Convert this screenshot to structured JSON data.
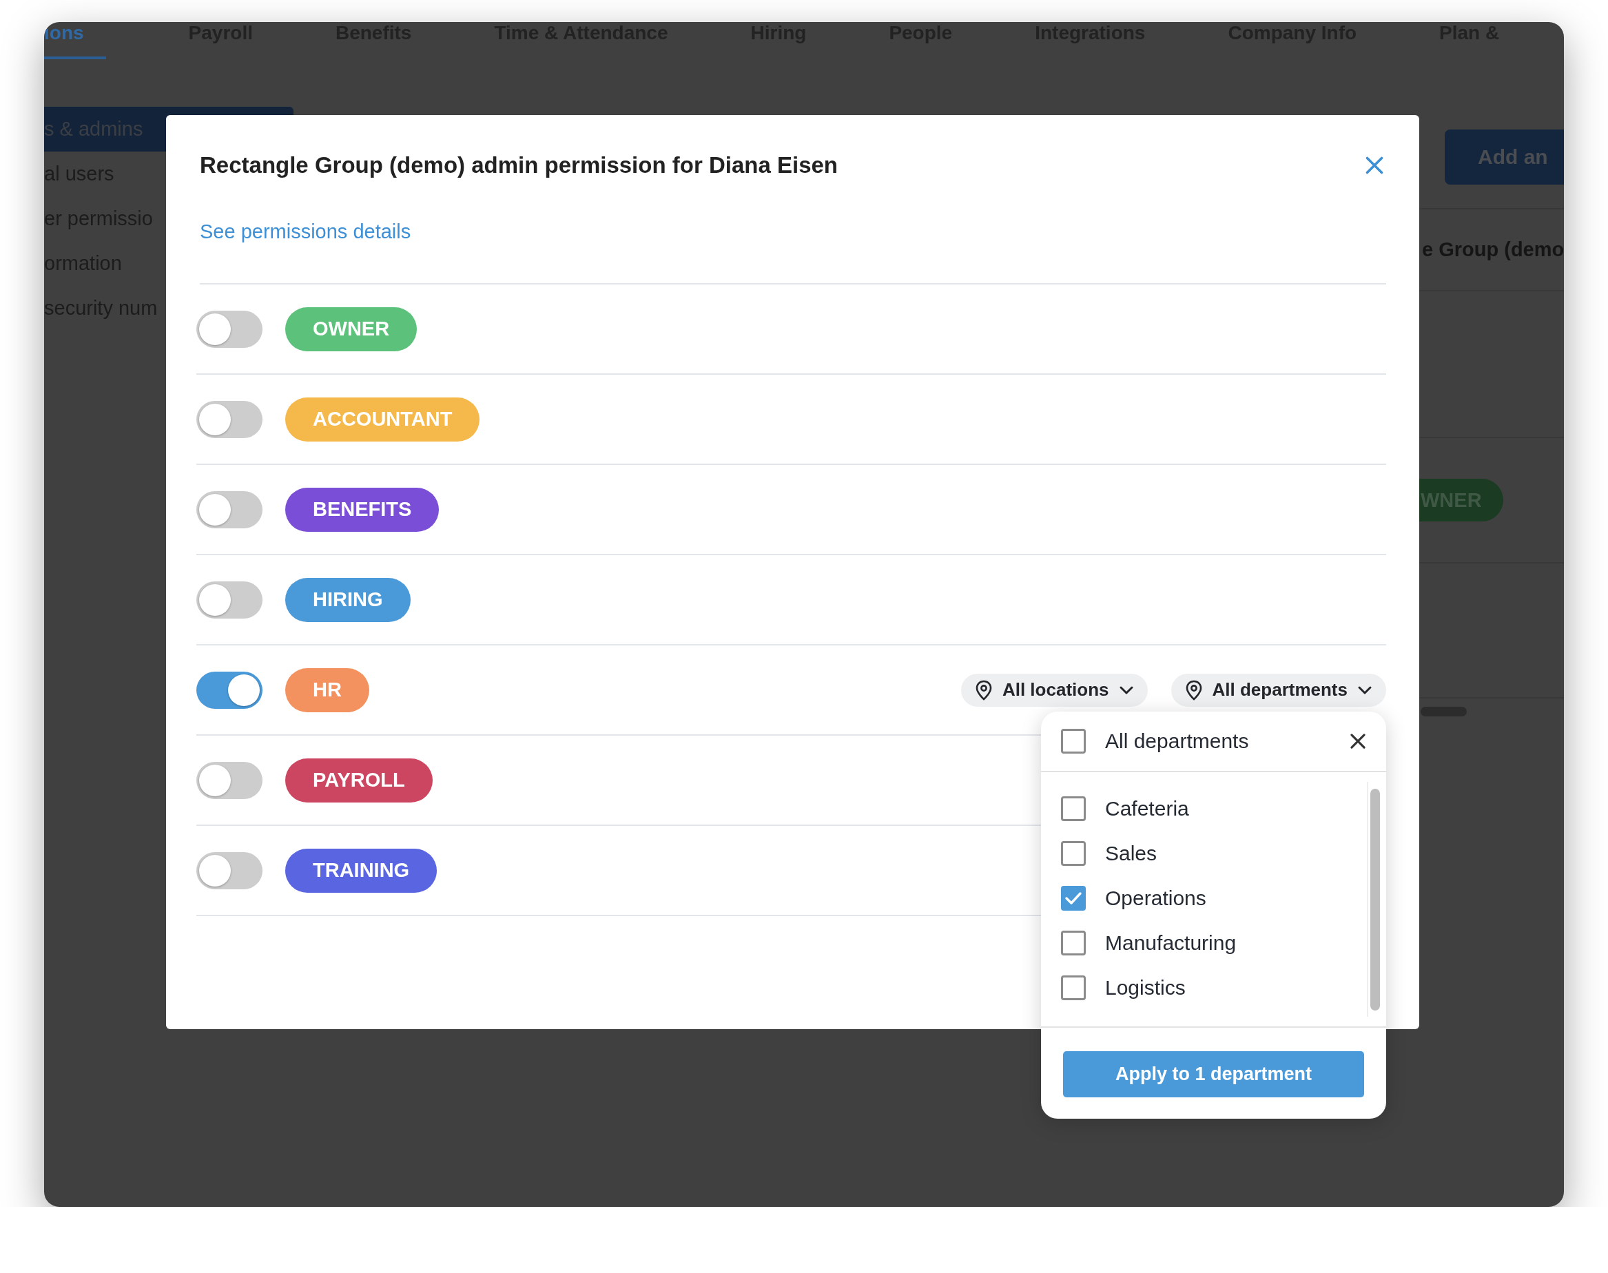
{
  "background": {
    "tabs": [
      {
        "label": "ions",
        "selected": true
      },
      {
        "label": "Payroll",
        "selected": false
      },
      {
        "label": "Benefits",
        "selected": false
      },
      {
        "label": "Time & Attendance",
        "selected": false
      },
      {
        "label": "Hiring",
        "selected": false
      },
      {
        "label": "People",
        "selected": false
      },
      {
        "label": "Integrations",
        "selected": false
      },
      {
        "label": "Company Info",
        "selected": false
      },
      {
        "label": "Plan &",
        "selected": false
      }
    ],
    "sidebar": {
      "items": [
        {
          "label": "s & admins",
          "selected": true
        },
        {
          "label": "al users",
          "selected": false
        },
        {
          "label": "er permissio",
          "selected": false
        },
        {
          "label": "ormation",
          "selected": false
        },
        {
          "label": "security num",
          "selected": false
        }
      ]
    },
    "add_button": "Add an",
    "company_name": "e Group (demo",
    "role_badge": "WNER"
  },
  "dialog": {
    "title": "Rectangle Group (demo) admin permission for Diana Eisen",
    "details_link": "See permissions details",
    "roles": [
      {
        "label": "OWNER",
        "color": "#5cc27b",
        "on": false
      },
      {
        "label": "ACCOUNTANT",
        "color": "#f5b84a",
        "on": false
      },
      {
        "label": "BENEFITS",
        "color": "#7a4ed6",
        "on": false
      },
      {
        "label": "HIRING",
        "color": "#4a9ad9",
        "on": false
      },
      {
        "label": "HR",
        "color": "#f3925e",
        "on": true,
        "filters": [
          {
            "label": "All locations"
          },
          {
            "label": "All departments",
            "menu": {
              "all_option": {
                "label": "All departments",
                "checked": false
              },
              "options": [
                {
                  "label": "Cafeteria",
                  "checked": false
                },
                {
                  "label": "Sales",
                  "checked": false
                },
                {
                  "label": "Operations",
                  "checked": true
                },
                {
                  "label": "Manufacturing",
                  "checked": false
                },
                {
                  "label": "Logistics",
                  "checked": false
                }
              ],
              "apply_button": "Apply to 1 department"
            }
          }
        ]
      },
      {
        "label": "PAYROLL",
        "color": "#cc4661",
        "on": false
      },
      {
        "label": "TRAINING",
        "color": "#5a66e1",
        "on": false
      }
    ]
  }
}
